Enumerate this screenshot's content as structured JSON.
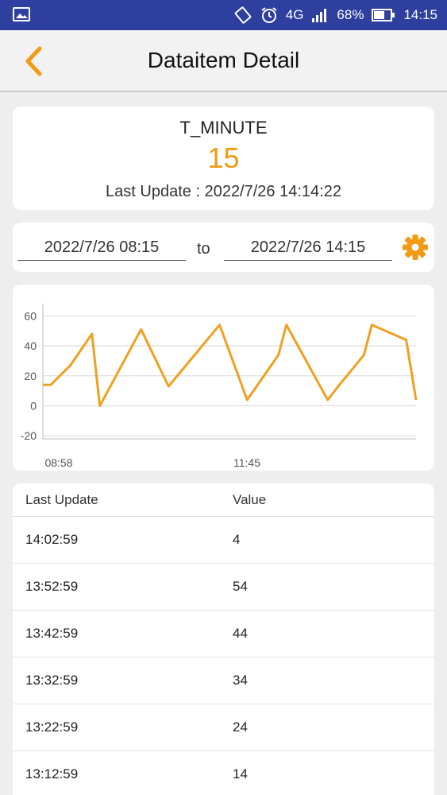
{
  "status_bar": {
    "network": "4G",
    "battery_percent": "68%",
    "time": "14:15",
    "icons": [
      "image-icon",
      "screen-rotate-icon",
      "alarm-icon",
      "signal-icon",
      "battery-icon"
    ]
  },
  "header": {
    "title": "Dataitem Detail",
    "back_icon": "chevron-left-icon"
  },
  "summary": {
    "name": "T_MINUTE",
    "value": "15",
    "last_update": "Last Update : 2022/7/26 14:14:22"
  },
  "range": {
    "from": "2022/7/26 08:15",
    "separator": "to",
    "to": "2022/7/26 14:15",
    "settings_icon": "gear-icon"
  },
  "chart_data": {
    "type": "line",
    "x": [
      0,
      8,
      28,
      50,
      58,
      100,
      128,
      180,
      208,
      240,
      248,
      290,
      302,
      327,
      335,
      370,
      380
    ],
    "y": [
      14,
      14,
      27,
      48,
      0,
      51,
      13,
      54,
      4,
      34,
      54,
      4,
      14,
      34,
      54,
      44,
      4
    ],
    "xtick_labels": [
      "08:58",
      "11:45"
    ],
    "yticks": [
      60,
      40,
      20,
      0,
      -20
    ],
    "ylim": [
      -22,
      66
    ],
    "grid": true,
    "title": "",
    "xlabel": "",
    "ylabel": ""
  },
  "colors": {
    "accent": "#f19a12",
    "status_bar": "#2f3fa0",
    "line": "#f0a020"
  },
  "table": {
    "columns": [
      "Last Update",
      "Value"
    ],
    "rows": [
      [
        "14:02:59",
        "4"
      ],
      [
        "13:52:59",
        "54"
      ],
      [
        "13:42:59",
        "44"
      ],
      [
        "13:32:59",
        "34"
      ],
      [
        "13:22:59",
        "24"
      ],
      [
        "13:12:59",
        "14"
      ]
    ]
  }
}
